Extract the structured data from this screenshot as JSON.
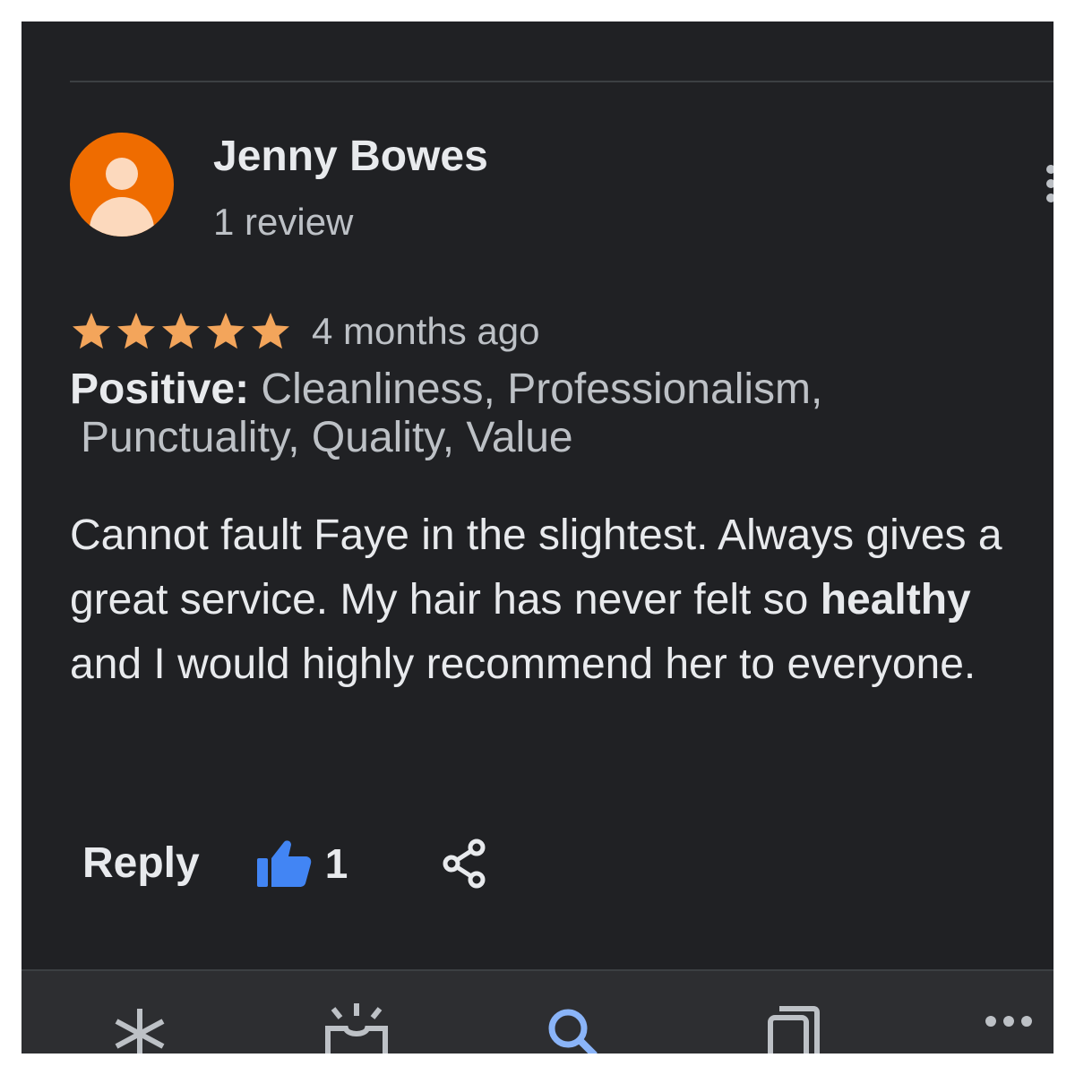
{
  "review": {
    "author": "Jenny Bowes",
    "review_count": "1 review",
    "rating": 5,
    "rating_max": 5,
    "time_ago": "4 months ago",
    "positive_label": "Positive:",
    "positive_items": "Cleanliness, Professionalism,",
    "positive_items_2": "Punctuality, Quality, Value",
    "text_part1": "Cannot fault Faye in the slightest. Always gives a great service. My hair has never felt so ",
    "text_bold": "healthy",
    "text_part2": " and I would highly recommend her to everyone.",
    "avatar_color": "#ef6c00",
    "star_color": "#f3a55b"
  },
  "actions": {
    "reply_label": "Reply",
    "like_count": "1",
    "like_icon": "thumbs-up-icon",
    "share_icon": "share-icon",
    "like_color": "#4285f4"
  },
  "bottom_nav": {
    "items": [
      {
        "icon": "asterisk-icon"
      },
      {
        "icon": "updates-icon"
      },
      {
        "icon": "search-icon",
        "active": true
      },
      {
        "icon": "saved-icon"
      },
      {
        "icon": "more-icon"
      }
    ],
    "active_color": "#8ab4f8"
  }
}
